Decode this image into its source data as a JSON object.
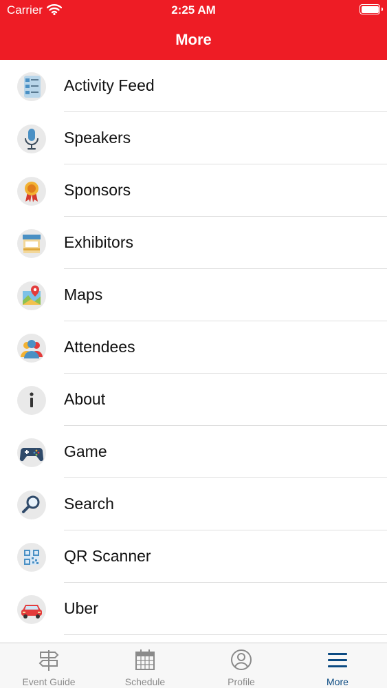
{
  "status_bar": {
    "carrier": "Carrier",
    "time": "2:25 AM"
  },
  "header": {
    "title": "More"
  },
  "menu": {
    "items": [
      {
        "label": "Activity Feed",
        "icon": "activity-feed-icon"
      },
      {
        "label": "Speakers",
        "icon": "microphone-icon"
      },
      {
        "label": "Sponsors",
        "icon": "ribbon-award-icon"
      },
      {
        "label": "Exhibitors",
        "icon": "booth-icon"
      },
      {
        "label": "Maps",
        "icon": "map-pin-icon"
      },
      {
        "label": "Attendees",
        "icon": "people-icon"
      },
      {
        "label": "About",
        "icon": "info-icon"
      },
      {
        "label": "Game",
        "icon": "gamepad-icon"
      },
      {
        "label": "Search",
        "icon": "magnifier-icon"
      },
      {
        "label": "QR Scanner",
        "icon": "qr-code-icon"
      },
      {
        "label": "Uber",
        "icon": "car-icon"
      }
    ]
  },
  "tab_bar": {
    "tabs": [
      {
        "label": "Event Guide",
        "icon": "signpost-icon",
        "active": false
      },
      {
        "label": "Schedule",
        "icon": "calendar-icon",
        "active": false
      },
      {
        "label": "Profile",
        "icon": "profile-icon",
        "active": false
      },
      {
        "label": "More",
        "icon": "hamburger-menu-icon",
        "active": true
      }
    ]
  },
  "colors": {
    "brand_red": "#ee1c25",
    "active_tab": "#0b4a82",
    "inactive_tab": "#8a8a8a"
  }
}
